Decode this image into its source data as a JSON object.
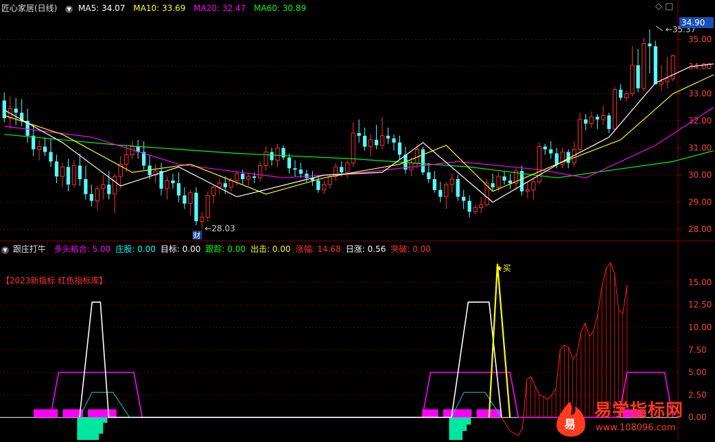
{
  "header": {
    "stock_name": "匠心家居(日线)",
    "ma5_label": "MA5: 34.07",
    "ma10_label": "MA10: 33.69",
    "ma20_label": "MA20: 32.47",
    "ma60_label": "MA60: 30.89",
    "toggle_icon": "circle-chevron-down-icon",
    "window_icons": "◇ □",
    "colors": {
      "ma5": "#ffffff",
      "ma10": "#ffff00",
      "ma20": "#ff00ff",
      "ma60": "#00ff00"
    }
  },
  "price_axis": {
    "ticks": [
      "35.00",
      "34.00",
      "33.00",
      "32.00",
      "31.00",
      "30.00",
      "29.00",
      "28.00"
    ],
    "current_price": "34.90"
  },
  "annotations": {
    "high": "35.37",
    "low": "28.03",
    "finance_badge": "财"
  },
  "indicator": {
    "name": "跟庄打牛",
    "fields": [
      {
        "label": "多头粘合: 5.00",
        "color": "#ff00ff"
      },
      {
        "label": "庄股: 0.00",
        "color": "#00ffff"
      },
      {
        "label": "目标: 0.00",
        "color": "#ffffff"
      },
      {
        "label": "跟踪: 0.00",
        "color": "#00ff00"
      },
      {
        "label": "出击: 0.00",
        "color": "#ffff00"
      },
      {
        "label": "涨幅: 14.68",
        "color": "#ff3030"
      },
      {
        "label": "日涨: 0.56",
        "color": "#ffffff"
      },
      {
        "label": "突破: 0.00",
        "color": "#ff3030"
      }
    ],
    "brand": "【2023新指标 红色指标库】",
    "buy_marker": "★买",
    "ticks": [
      "15.00",
      "12.50",
      "10.00",
      "7.50",
      "5.00",
      "2.50",
      "0.00"
    ]
  },
  "watermark": {
    "text": "易学指标网",
    "url": "www.108096.com",
    "logo_char": "易",
    "color": "#ff3a1e"
  },
  "chart_data": {
    "type": "candlestick",
    "price_range": [
      27.7,
      36.0
    ],
    "indicator_range": [
      -2.5,
      18.0
    ],
    "ohlc": [
      [
        32.75,
        33.05,
        31.95,
        32.1
      ],
      [
        32.1,
        32.9,
        31.7,
        32.45
      ],
      [
        32.45,
        32.85,
        31.85,
        32.3
      ],
      [
        32.3,
        32.8,
        31.8,
        32.0
      ],
      [
        32.0,
        32.45,
        31.2,
        31.45
      ],
      [
        31.45,
        31.85,
        30.7,
        30.95
      ],
      [
        30.95,
        31.3,
        30.55,
        31.05
      ],
      [
        31.05,
        31.4,
        30.7,
        30.85
      ],
      [
        30.85,
        31.35,
        30.3,
        30.5
      ],
      [
        30.5,
        30.75,
        29.7,
        29.95
      ],
      [
        29.95,
        30.45,
        29.55,
        30.3
      ],
      [
        30.3,
        30.6,
        29.4,
        29.65
      ],
      [
        29.65,
        30.55,
        29.55,
        30.35
      ],
      [
        30.35,
        30.8,
        29.6,
        29.85
      ],
      [
        29.85,
        30.35,
        29.1,
        29.3
      ],
      [
        29.3,
        29.65,
        28.85,
        29.05
      ],
      [
        29.05,
        29.6,
        28.7,
        29.5
      ],
      [
        29.5,
        30.0,
        29.1,
        29.65
      ],
      [
        29.65,
        30.15,
        29.1,
        29.3
      ],
      [
        29.3,
        30.05,
        28.6,
        29.95
      ],
      [
        29.95,
        30.7,
        29.5,
        30.4
      ],
      [
        30.4,
        31.1,
        30.1,
        30.75
      ],
      [
        30.75,
        31.25,
        30.6,
        31.05
      ],
      [
        31.05,
        31.3,
        30.6,
        30.85
      ],
      [
        30.85,
        31.25,
        30.2,
        30.35
      ],
      [
        30.35,
        30.75,
        29.85,
        30.0
      ],
      [
        30.0,
        30.4,
        29.7,
        30.15
      ],
      [
        30.15,
        30.45,
        29.25,
        29.5
      ],
      [
        29.5,
        29.95,
        29.1,
        29.8
      ],
      [
        29.8,
        30.05,
        29.5,
        29.7
      ],
      [
        29.7,
        30.1,
        29.0,
        29.25
      ],
      [
        29.25,
        29.55,
        28.75,
        28.95
      ],
      [
        28.95,
        29.45,
        28.5,
        29.35
      ],
      [
        29.35,
        29.55,
        28.15,
        28.3
      ],
      [
        28.3,
        28.65,
        28.03,
        28.45
      ],
      [
        28.45,
        29.4,
        28.3,
        29.25
      ],
      [
        29.25,
        29.6,
        28.95,
        29.55
      ],
      [
        29.55,
        29.85,
        29.3,
        29.7
      ],
      [
        29.7,
        29.95,
        29.3,
        29.55
      ],
      [
        29.55,
        29.9,
        29.4,
        29.8
      ],
      [
        29.8,
        30.15,
        29.6,
        30.05
      ],
      [
        30.05,
        30.2,
        29.65,
        29.85
      ],
      [
        29.85,
        30.05,
        29.6,
        29.95
      ],
      [
        29.95,
        30.1,
        29.7,
        29.9
      ],
      [
        29.9,
        30.5,
        29.75,
        30.35
      ],
      [
        30.35,
        31.05,
        30.15,
        30.85
      ],
      [
        30.85,
        31.0,
        30.35,
        30.55
      ],
      [
        30.55,
        31.15,
        30.3,
        31.0
      ],
      [
        31.0,
        31.1,
        30.55,
        30.65
      ],
      [
        30.65,
        30.8,
        30.05,
        30.25
      ],
      [
        30.25,
        30.55,
        29.95,
        30.2
      ],
      [
        30.2,
        30.45,
        29.9,
        30.05
      ],
      [
        30.05,
        30.2,
        29.75,
        29.9
      ],
      [
        29.9,
        30.15,
        29.6,
        29.8
      ],
      [
        29.8,
        29.95,
        29.35,
        29.45
      ],
      [
        29.45,
        29.8,
        29.3,
        29.65
      ],
      [
        29.65,
        30.0,
        29.5,
        29.95
      ],
      [
        29.95,
        30.45,
        29.8,
        30.3
      ],
      [
        30.3,
        30.5,
        29.95,
        30.1
      ],
      [
        30.1,
        30.55,
        29.9,
        30.45
      ],
      [
        30.45,
        31.95,
        30.3,
        31.55
      ],
      [
        31.55,
        32.05,
        31.2,
        31.45
      ],
      [
        31.45,
        31.75,
        30.9,
        31.05
      ],
      [
        31.05,
        31.5,
        30.7,
        31.3
      ],
      [
        31.3,
        31.85,
        30.95,
        31.1
      ],
      [
        31.1,
        32.15,
        30.95,
        31.45
      ],
      [
        31.45,
        31.75,
        31.15,
        31.35
      ],
      [
        31.35,
        31.5,
        30.9,
        31.2
      ],
      [
        31.2,
        31.45,
        30.55,
        30.75
      ],
      [
        30.75,
        31.05,
        30.05,
        30.2
      ],
      [
        30.2,
        30.65,
        29.95,
        30.45
      ],
      [
        30.45,
        31.15,
        30.25,
        30.95
      ],
      [
        30.95,
        31.05,
        30.0,
        30.1
      ],
      [
        30.1,
        30.45,
        29.7,
        29.85
      ],
      [
        29.85,
        30.15,
        29.35,
        29.45
      ],
      [
        29.45,
        29.75,
        29.0,
        29.2
      ],
      [
        29.2,
        29.75,
        28.75,
        29.65
      ],
      [
        29.65,
        30.05,
        29.35,
        29.85
      ],
      [
        29.85,
        30.0,
        29.05,
        29.2
      ],
      [
        29.2,
        29.45,
        28.75,
        29.05
      ],
      [
        29.05,
        29.25,
        28.45,
        28.65
      ],
      [
        28.65,
        28.9,
        28.55,
        28.8
      ],
      [
        28.8,
        29.2,
        28.6,
        28.9
      ],
      [
        28.9,
        29.85,
        28.85,
        29.7
      ],
      [
        29.7,
        30.05,
        29.4,
        29.55
      ],
      [
        29.55,
        30.1,
        29.4,
        29.95
      ],
      [
        29.95,
        30.15,
        29.65,
        29.8
      ],
      [
        29.8,
        30.05,
        29.5,
        29.7
      ],
      [
        29.7,
        30.25,
        29.45,
        30.15
      ],
      [
        30.15,
        30.35,
        29.25,
        29.4
      ],
      [
        29.4,
        29.75,
        29.15,
        29.45
      ],
      [
        29.45,
        29.85,
        29.1,
        29.75
      ],
      [
        29.75,
        31.2,
        29.65,
        31.05
      ],
      [
        31.05,
        31.15,
        30.75,
        30.95
      ],
      [
        30.95,
        31.25,
        30.6,
        30.8
      ],
      [
        30.8,
        31.0,
        30.25,
        30.4
      ],
      [
        30.4,
        31.0,
        30.25,
        30.85
      ],
      [
        30.85,
        30.95,
        30.25,
        30.45
      ],
      [
        30.45,
        31.25,
        30.3,
        30.95
      ],
      [
        30.95,
        32.3,
        30.85,
        32.05
      ],
      [
        32.05,
        32.25,
        31.65,
        31.9
      ],
      [
        31.9,
        32.35,
        31.75,
        32.15
      ],
      [
        32.15,
        32.25,
        31.7,
        32.05
      ],
      [
        32.05,
        32.55,
        31.85,
        32.2
      ],
      [
        32.2,
        32.3,
        31.55,
        31.7
      ],
      [
        31.7,
        33.25,
        31.6,
        33.15
      ],
      [
        33.15,
        33.35,
        32.75,
        32.85
      ],
      [
        32.85,
        33.1,
        32.7,
        33.0
      ],
      [
        33.0,
        34.75,
        32.9,
        34.05
      ],
      [
        34.05,
        34.65,
        33.05,
        33.2
      ],
      [
        33.2,
        35.05,
        33.1,
        34.85
      ],
      [
        34.85,
        35.37,
        33.75,
        34.75
      ],
      [
        34.75,
        34.95,
        33.35,
        33.35
      ],
      [
        33.35,
        34.05,
        33.1,
        33.45
      ],
      [
        33.45,
        34.35,
        33.2,
        33.55
      ],
      [
        33.55,
        34.45,
        33.45,
        34.4
      ]
    ],
    "ma": {
      "ma5": [
        [
          0,
          32.4
        ],
        [
          10,
          31.2
        ],
        [
          20,
          29.6
        ],
        [
          30,
          30.3
        ],
        [
          40,
          29.2
        ],
        [
          55,
          30.0
        ],
        [
          65,
          30.1
        ],
        [
          72,
          31.2
        ],
        [
          84,
          29.0
        ],
        [
          96,
          30.5
        ],
        [
          104,
          31.4
        ],
        [
          112,
          33.4
        ],
        [
          118,
          34.0
        ],
        [
          122,
          34.1
        ]
      ],
      "ma10": [
        [
          0,
          32.2
        ],
        [
          10,
          31.5
        ],
        [
          22,
          30.1
        ],
        [
          32,
          30.4
        ],
        [
          45,
          29.3
        ],
        [
          55,
          29.9
        ],
        [
          68,
          30.4
        ],
        [
          76,
          31.1
        ],
        [
          84,
          29.4
        ],
        [
          95,
          30.4
        ],
        [
          106,
          31.3
        ],
        [
          115,
          33.0
        ],
        [
          122,
          33.7
        ]
      ],
      "ma20": [
        [
          0,
          31.8
        ],
        [
          15,
          31.4
        ],
        [
          30,
          30.4
        ],
        [
          48,
          29.9
        ],
        [
          62,
          30.1
        ],
        [
          78,
          30.5
        ],
        [
          92,
          30.2
        ],
        [
          100,
          29.9
        ],
        [
          112,
          31.1
        ],
        [
          122,
          32.5
        ]
      ],
      "ma60": [
        [
          0,
          31.5
        ],
        [
          20,
          31.1
        ],
        [
          40,
          30.8
        ],
        [
          60,
          30.6
        ],
        [
          80,
          30.3
        ],
        [
          95,
          29.9
        ],
        [
          105,
          30.2
        ],
        [
          115,
          30.5
        ],
        [
          122,
          30.9
        ]
      ]
    },
    "indicator_series": {
      "magenta_band": [
        [
          11,
          0
        ],
        [
          13,
          5.0
        ],
        [
          31,
          5.0
        ],
        [
          33,
          0
        ],
        [
          100,
          0
        ],
        [
          102,
          5.0
        ],
        [
          121,
          5.0
        ],
        [
          123,
          0
        ],
        [
          147,
          0
        ],
        [
          149,
          5.0
        ],
        [
          158,
          5.0
        ],
        [
          160,
          0
        ]
      ],
      "white_spike": [
        [
          18,
          0
        ],
        [
          21,
          12.8
        ],
        [
          23,
          12.8
        ],
        [
          25,
          0
        ],
        [
          107,
          0
        ],
        [
          111,
          12.8
        ],
        [
          116,
          12.8
        ],
        [
          119,
          0
        ]
      ],
      "cyan_hump": [
        [
          18,
          0
        ],
        [
          21,
          2.8
        ],
        [
          26,
          2.8
        ],
        [
          30,
          0
        ],
        [
          107,
          0
        ],
        [
          110,
          2.8
        ],
        [
          115,
          2.8
        ],
        [
          119,
          0
        ]
      ],
      "yellow_spike": [
        [
          116,
          0
        ],
        [
          118,
          17.0
        ],
        [
          121,
          0
        ]
      ],
      "red_line": [
        [
          119,
          0
        ],
        [
          121,
          -1.5
        ],
        [
          123,
          -2.0
        ],
        [
          124,
          -1.2
        ],
        [
          125,
          4.2
        ],
        [
          126,
          4.5
        ],
        [
          127,
          3.5
        ],
        [
          128,
          2.5
        ],
        [
          129,
          2.3
        ],
        [
          130,
          2.0
        ],
        [
          131,
          2.5
        ],
        [
          132,
          3.2
        ],
        [
          133,
          7.5
        ],
        [
          134,
          8.0
        ],
        [
          135,
          7.8
        ],
        [
          136,
          6.5
        ],
        [
          137,
          7.0
        ],
        [
          138,
          9.5
        ],
        [
          139,
          10.5
        ],
        [
          140,
          9.0
        ],
        [
          141,
          9.6
        ],
        [
          142,
          11.5
        ],
        [
          143,
          14.5
        ],
        [
          144,
          16.5
        ],
        [
          145,
          17.2
        ],
        [
          146,
          16.0
        ],
        [
          147,
          12.0
        ],
        [
          148,
          11.5
        ],
        [
          149,
          14.7
        ]
      ],
      "green_bars": [
        [
          18,
          -5.0
        ],
        [
          19,
          -5.0
        ],
        [
          20,
          -4.8
        ],
        [
          21,
          -4.0
        ],
        [
          22,
          -2.8
        ],
        [
          23,
          -1.8
        ],
        [
          24,
          -0.6
        ],
        [
          107,
          -4.2
        ],
        [
          108,
          -3.6
        ],
        [
          109,
          -2.8
        ],
        [
          110,
          -1.5
        ],
        [
          111,
          -0.8
        ]
      ],
      "magenta_blocks": [
        [
          7,
          13
        ],
        [
          14,
          19
        ],
        [
          20,
          27
        ],
        [
          100,
          104
        ],
        [
          105,
          112
        ],
        [
          113,
          119
        ],
        [
          148,
          153
        ]
      ]
    }
  }
}
